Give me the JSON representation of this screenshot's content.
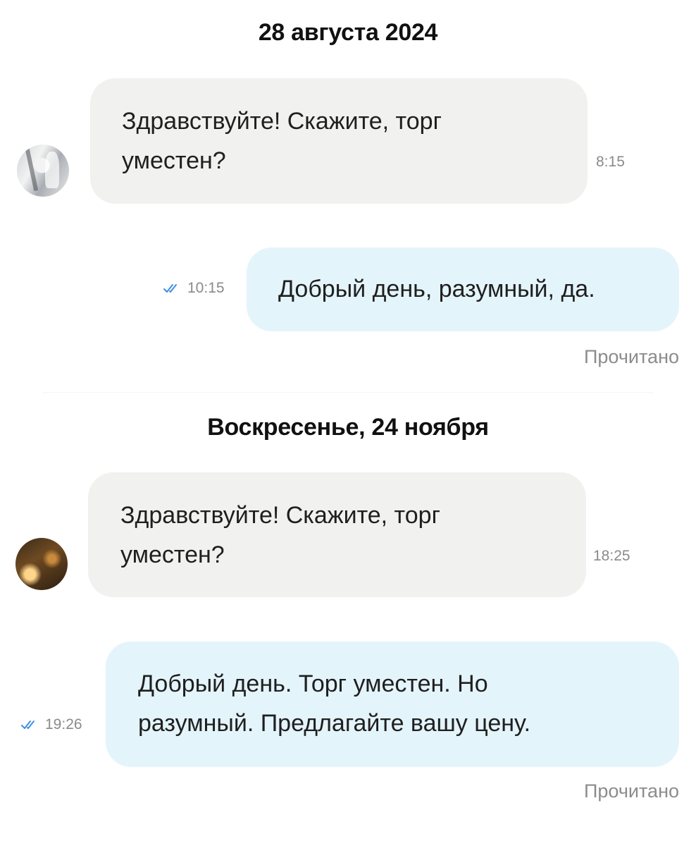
{
  "chat": {
    "date_1": "28 августа 2024",
    "date_2": "Воскресенье, 24 ноября",
    "messages": [
      {
        "direction": "incoming",
        "text": "Здравствуйте! Скажите, торг\nуместен?",
        "time": "8:15"
      },
      {
        "direction": "outgoing",
        "text": "Добрый день, разумный, да.",
        "time": "10:15",
        "status": "Прочитано"
      },
      {
        "direction": "incoming",
        "text": "Здравствуйте! Скажите, торг\nуместен?",
        "time": "18:25"
      },
      {
        "direction": "outgoing",
        "text": "Добрый день. Торг уместен. Но\nразумный. Предлагайте вашу цену.",
        "time": "19:26",
        "status": "Прочитано"
      }
    ]
  },
  "colors": {
    "incoming_bubble": "#f1f1ef",
    "outgoing_bubble": "#e4f4fb",
    "read_check": "#3f8fe0"
  },
  "icons": {
    "read_check": "double-check-icon"
  }
}
